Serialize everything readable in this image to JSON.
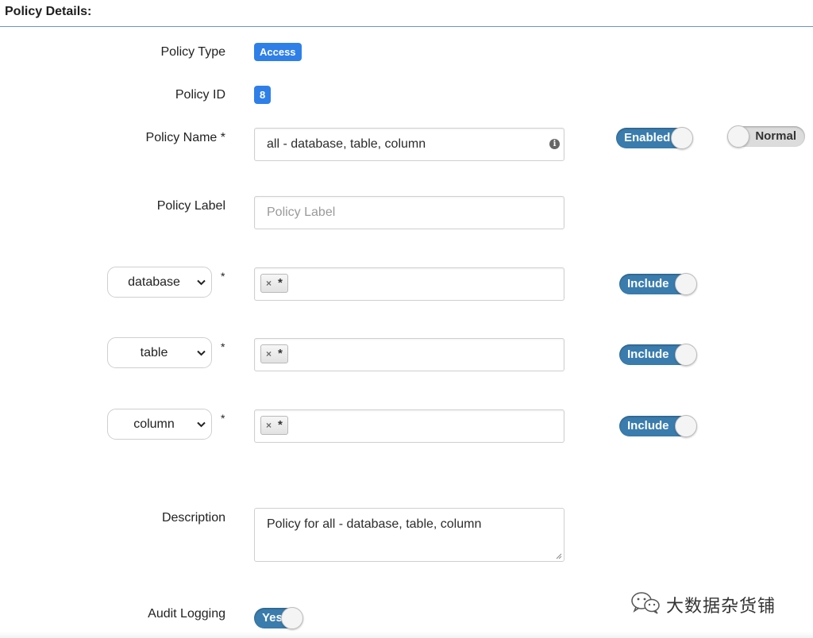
{
  "section": {
    "title": "Policy Details:"
  },
  "policy_type": {
    "label": "Policy Type",
    "value": "Access"
  },
  "policy_id": {
    "label": "Policy ID",
    "value": "8"
  },
  "policy_name": {
    "label": "Policy Name *",
    "value": "all - database, table, column",
    "enabled_toggle": "Enabled",
    "override_toggle": "Normal"
  },
  "policy_label": {
    "label": "Policy Label",
    "placeholder": "Policy Label"
  },
  "resources": [
    {
      "type": "database",
      "required": "*",
      "tag_remove": "×",
      "tag_value": "*",
      "include": "Include"
    },
    {
      "type": "table",
      "required": "*",
      "tag_remove": "×",
      "tag_value": "*",
      "include": "Include"
    },
    {
      "type": "column",
      "required": "*",
      "tag_remove": "×",
      "tag_value": "*",
      "include": "Include"
    }
  ],
  "description": {
    "label": "Description",
    "value": "Policy for all - database, table, column"
  },
  "audit_logging": {
    "label": "Audit Logging",
    "value": "Yes"
  },
  "watermark": {
    "text": "大数据杂货铺"
  },
  "colors": {
    "badge": "#2f7fe8",
    "toggle_on": "#3a7cad",
    "toggle_off": "#dcdcdc",
    "rule": "#6f93b8"
  }
}
